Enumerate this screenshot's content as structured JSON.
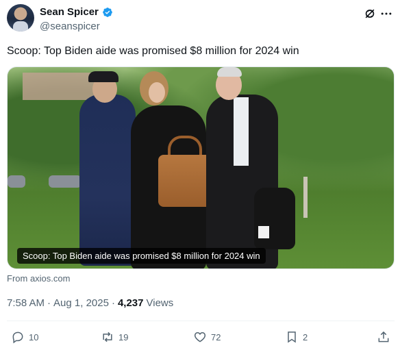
{
  "author": {
    "display_name": "Sean Spicer",
    "handle": "@seanspicer",
    "verified_color": "#1d9bf0"
  },
  "header_icons": [
    "grok-icon",
    "more-icon"
  ],
  "tweet": {
    "text": "Scoop: Top Biden aide was promised $8 million for 2024 win",
    "media_caption": "Scoop: Top Biden aide was promised $8 million for 2024 win",
    "source": "From axios.com"
  },
  "meta": {
    "time": "7:58 AM",
    "separator": "·",
    "date": "Aug 1, 2025",
    "views_count": "4,237",
    "views_label": "Views"
  },
  "actions": {
    "replies": "10",
    "reposts": "19",
    "likes": "72",
    "bookmarks": "2"
  }
}
